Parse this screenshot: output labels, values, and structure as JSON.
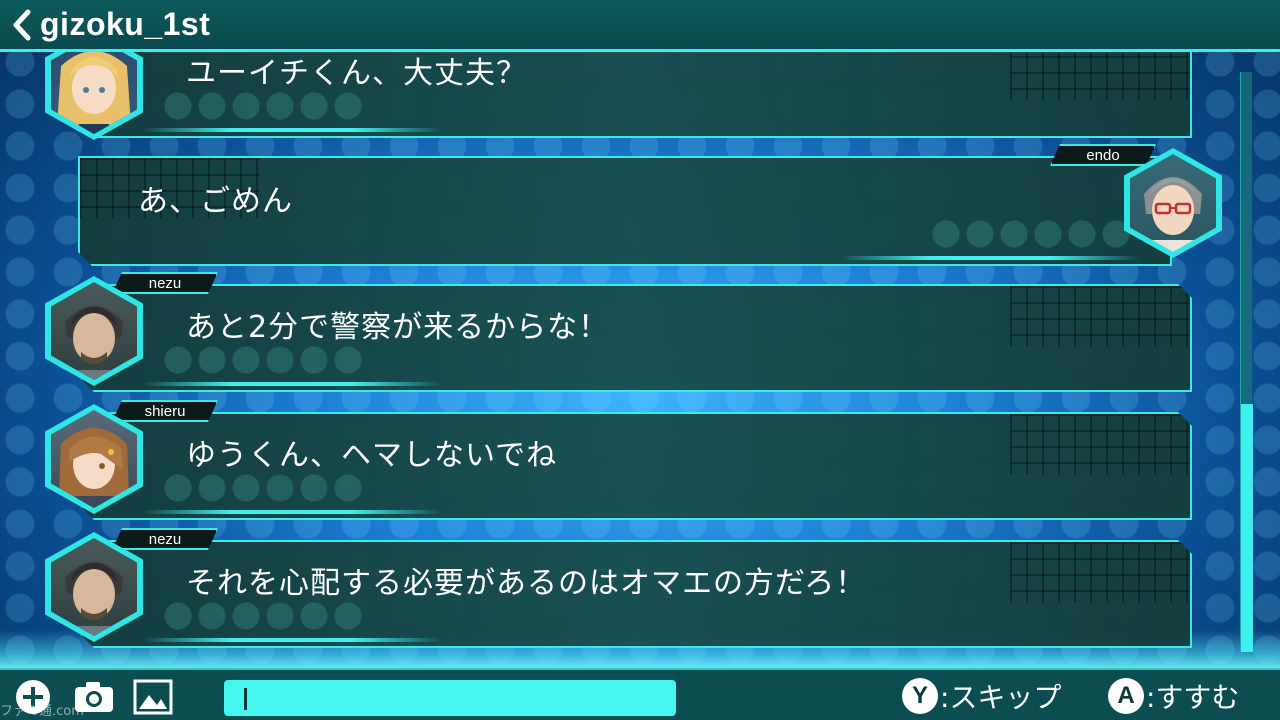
{
  "header": {
    "title": "gizoku_1st",
    "back_icon": "chevron-left-icon"
  },
  "messages": [
    {
      "speaker": "",
      "side": "left",
      "text": "ユーイチくん、大丈夫？",
      "avatar": "blonde-girl-avatar"
    },
    {
      "speaker": "endo",
      "side": "right",
      "text": "あ、ごめん",
      "avatar": "glasses-boy-avatar"
    },
    {
      "speaker": "nezu",
      "side": "left",
      "text": "あと2分で警察が来るからな！",
      "avatar": "bearded-man-avatar"
    },
    {
      "speaker": "shieru",
      "side": "left",
      "text": "ゆうくん、ヘマしないでね",
      "avatar": "brown-hair-girl-avatar"
    },
    {
      "speaker": "nezu",
      "side": "left",
      "text": "それを心配する必要があるのはオマエの方だろ！",
      "avatar": "bearded-man-avatar"
    }
  ],
  "toolbar": {
    "add_icon": "plus-circle-icon",
    "camera_icon": "camera-icon",
    "image_icon": "image-icon",
    "input_value": ""
  },
  "hints": {
    "skip_button": "Y",
    "skip_label": ":スキップ",
    "next_button": "A",
    "next_label": ":すすむ"
  },
  "watermark": "ファミ通.com",
  "colors": {
    "accent": "#3fe8e0",
    "header_bg": "#0e5a5c",
    "bubble_bg": "#184e4e",
    "input_bg": "#45f5ee"
  }
}
